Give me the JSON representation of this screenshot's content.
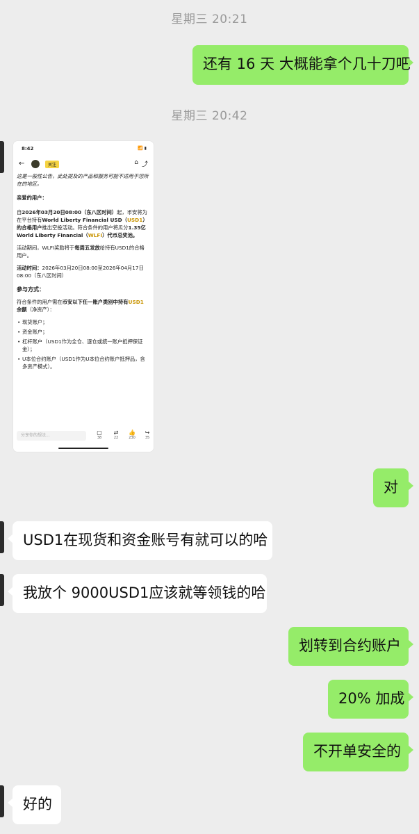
{
  "timestamps": [
    "星期三 20:21",
    "星期三 20:42"
  ],
  "messages": {
    "m1": "还有 16 天 大概能拿个几十刀吧",
    "m2": "对",
    "m3": "USD1在现货和资金账号有就可以的哈",
    "m4": "我放个 9000USD1应该就等领钱的哈",
    "m5": "划转到合约账户",
    "m6": "20% 加成",
    "m7": "不开单安全的",
    "m8": "好的"
  },
  "card": {
    "status_time": "8:42",
    "status_icons": "📶 ▮",
    "follow_label": "关注",
    "disclaimer": "这是一般性公告，此处提及的产品和服务可能不适用于您所在的地区。",
    "greeting": "亲爱的用户：",
    "p1_a": "自",
    "p1_bold": "2026年03月20日08:00（东八区时间）",
    "p1_b": "起，币安将为在平台持有",
    "p1_bold2": "World Liberty Financial USD（",
    "p1_usd1": "USD1",
    "p1_bold3": "）的合格用户",
    "p1_c": "推出空投活动。符合条件的用户将瓜分",
    "p1_bold4": "1.35亿World Liberty Financial（",
    "p1_wlfi": "WLFI",
    "p1_bold5": "）代币总奖池。",
    "p2_a": "活动期间，WLFI奖励将于",
    "p2_bold": "每周五发放",
    "p2_b": "给持有USD1的合格用户。",
    "p3_bold": "活动时间：",
    "p3_rest": "2026年03月20日08:00至2026年04月17日08:00（东八区时间）",
    "section_title": "参与方式：",
    "p4_a": "符合条件的用户需在",
    "p4_bold": "币安以下任一账户类别中持有",
    "p4_usd1": "USD1",
    "p4_bold2": "余额",
    "p4_b": "（净资产）：",
    "list": [
      "现货账户；",
      "资金账户；",
      "杠杆账户（USD1作为全仓、逐仓或统一账户抵押保证金）；",
      "U本位合约账户（USD1作为U本位合约账户抵押品，含多资产模式）。"
    ],
    "comment_placeholder": "分享你的想法...",
    "actions": [
      {
        "icon": "comment-icon",
        "glyph": "▢",
        "count": "38"
      },
      {
        "icon": "repost-icon",
        "glyph": "⇄",
        "count": "22"
      },
      {
        "icon": "like-icon",
        "glyph": "👍",
        "count": "230"
      },
      {
        "icon": "share-icon",
        "glyph": "↪",
        "count": "35"
      }
    ]
  }
}
